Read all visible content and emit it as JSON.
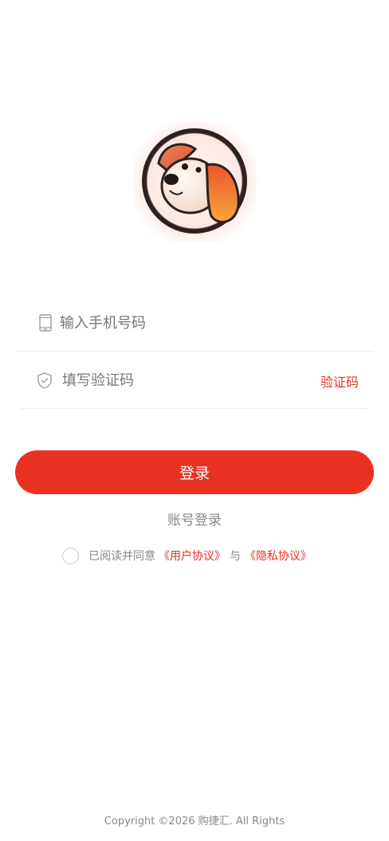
{
  "logo": {
    "icon": "dog-logo-icon"
  },
  "phone": {
    "placeholder": "输入手机号码",
    "icon": "phone-icon"
  },
  "code": {
    "placeholder": "填写验证码",
    "icon": "shield-check-icon",
    "get_code_label": "验证码"
  },
  "login_button": "登录",
  "account_login": "账号登录",
  "agreement": {
    "prefix": "已阅读并同意",
    "user_agreement": "《用户协议》",
    "and": "与",
    "privacy_policy": "《隐私协议》"
  },
  "footer": "Copyright ©2026 购捷汇. All Rights",
  "colors": {
    "accent": "#e83323",
    "link": "#e53222",
    "muted": "#888888"
  }
}
